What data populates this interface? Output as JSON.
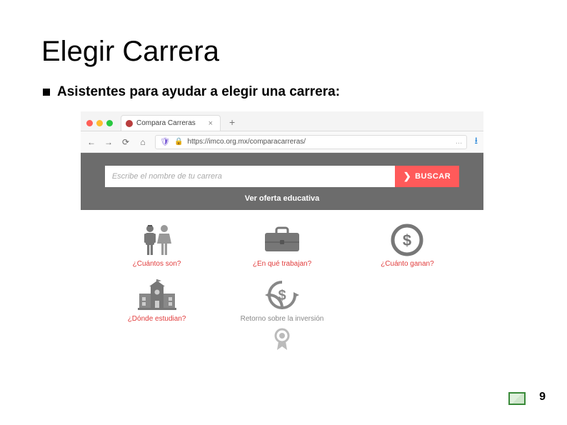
{
  "slide": {
    "title": "Elegir Carrera",
    "bullet": "Asistentes para ayudar a elegir una carrera:",
    "page_number": "9"
  },
  "browser": {
    "tab_title": "Compara Carreras",
    "url": "https://imco.org.mx/comparacarreras/",
    "dots_label": "…"
  },
  "page": {
    "search_placeholder": "Escribe el nombre de tu carrera",
    "search_button": "BUSCAR",
    "oferta_label": "Ver oferta educativa",
    "cells": {
      "cuantos": "¿Cuántos son?",
      "trabajan": "¿En qué trabajan?",
      "ganan": "¿Cuánto ganan?",
      "estudian": "¿Dónde estudian?",
      "retorno": "Retorno sobre la inversión"
    }
  }
}
